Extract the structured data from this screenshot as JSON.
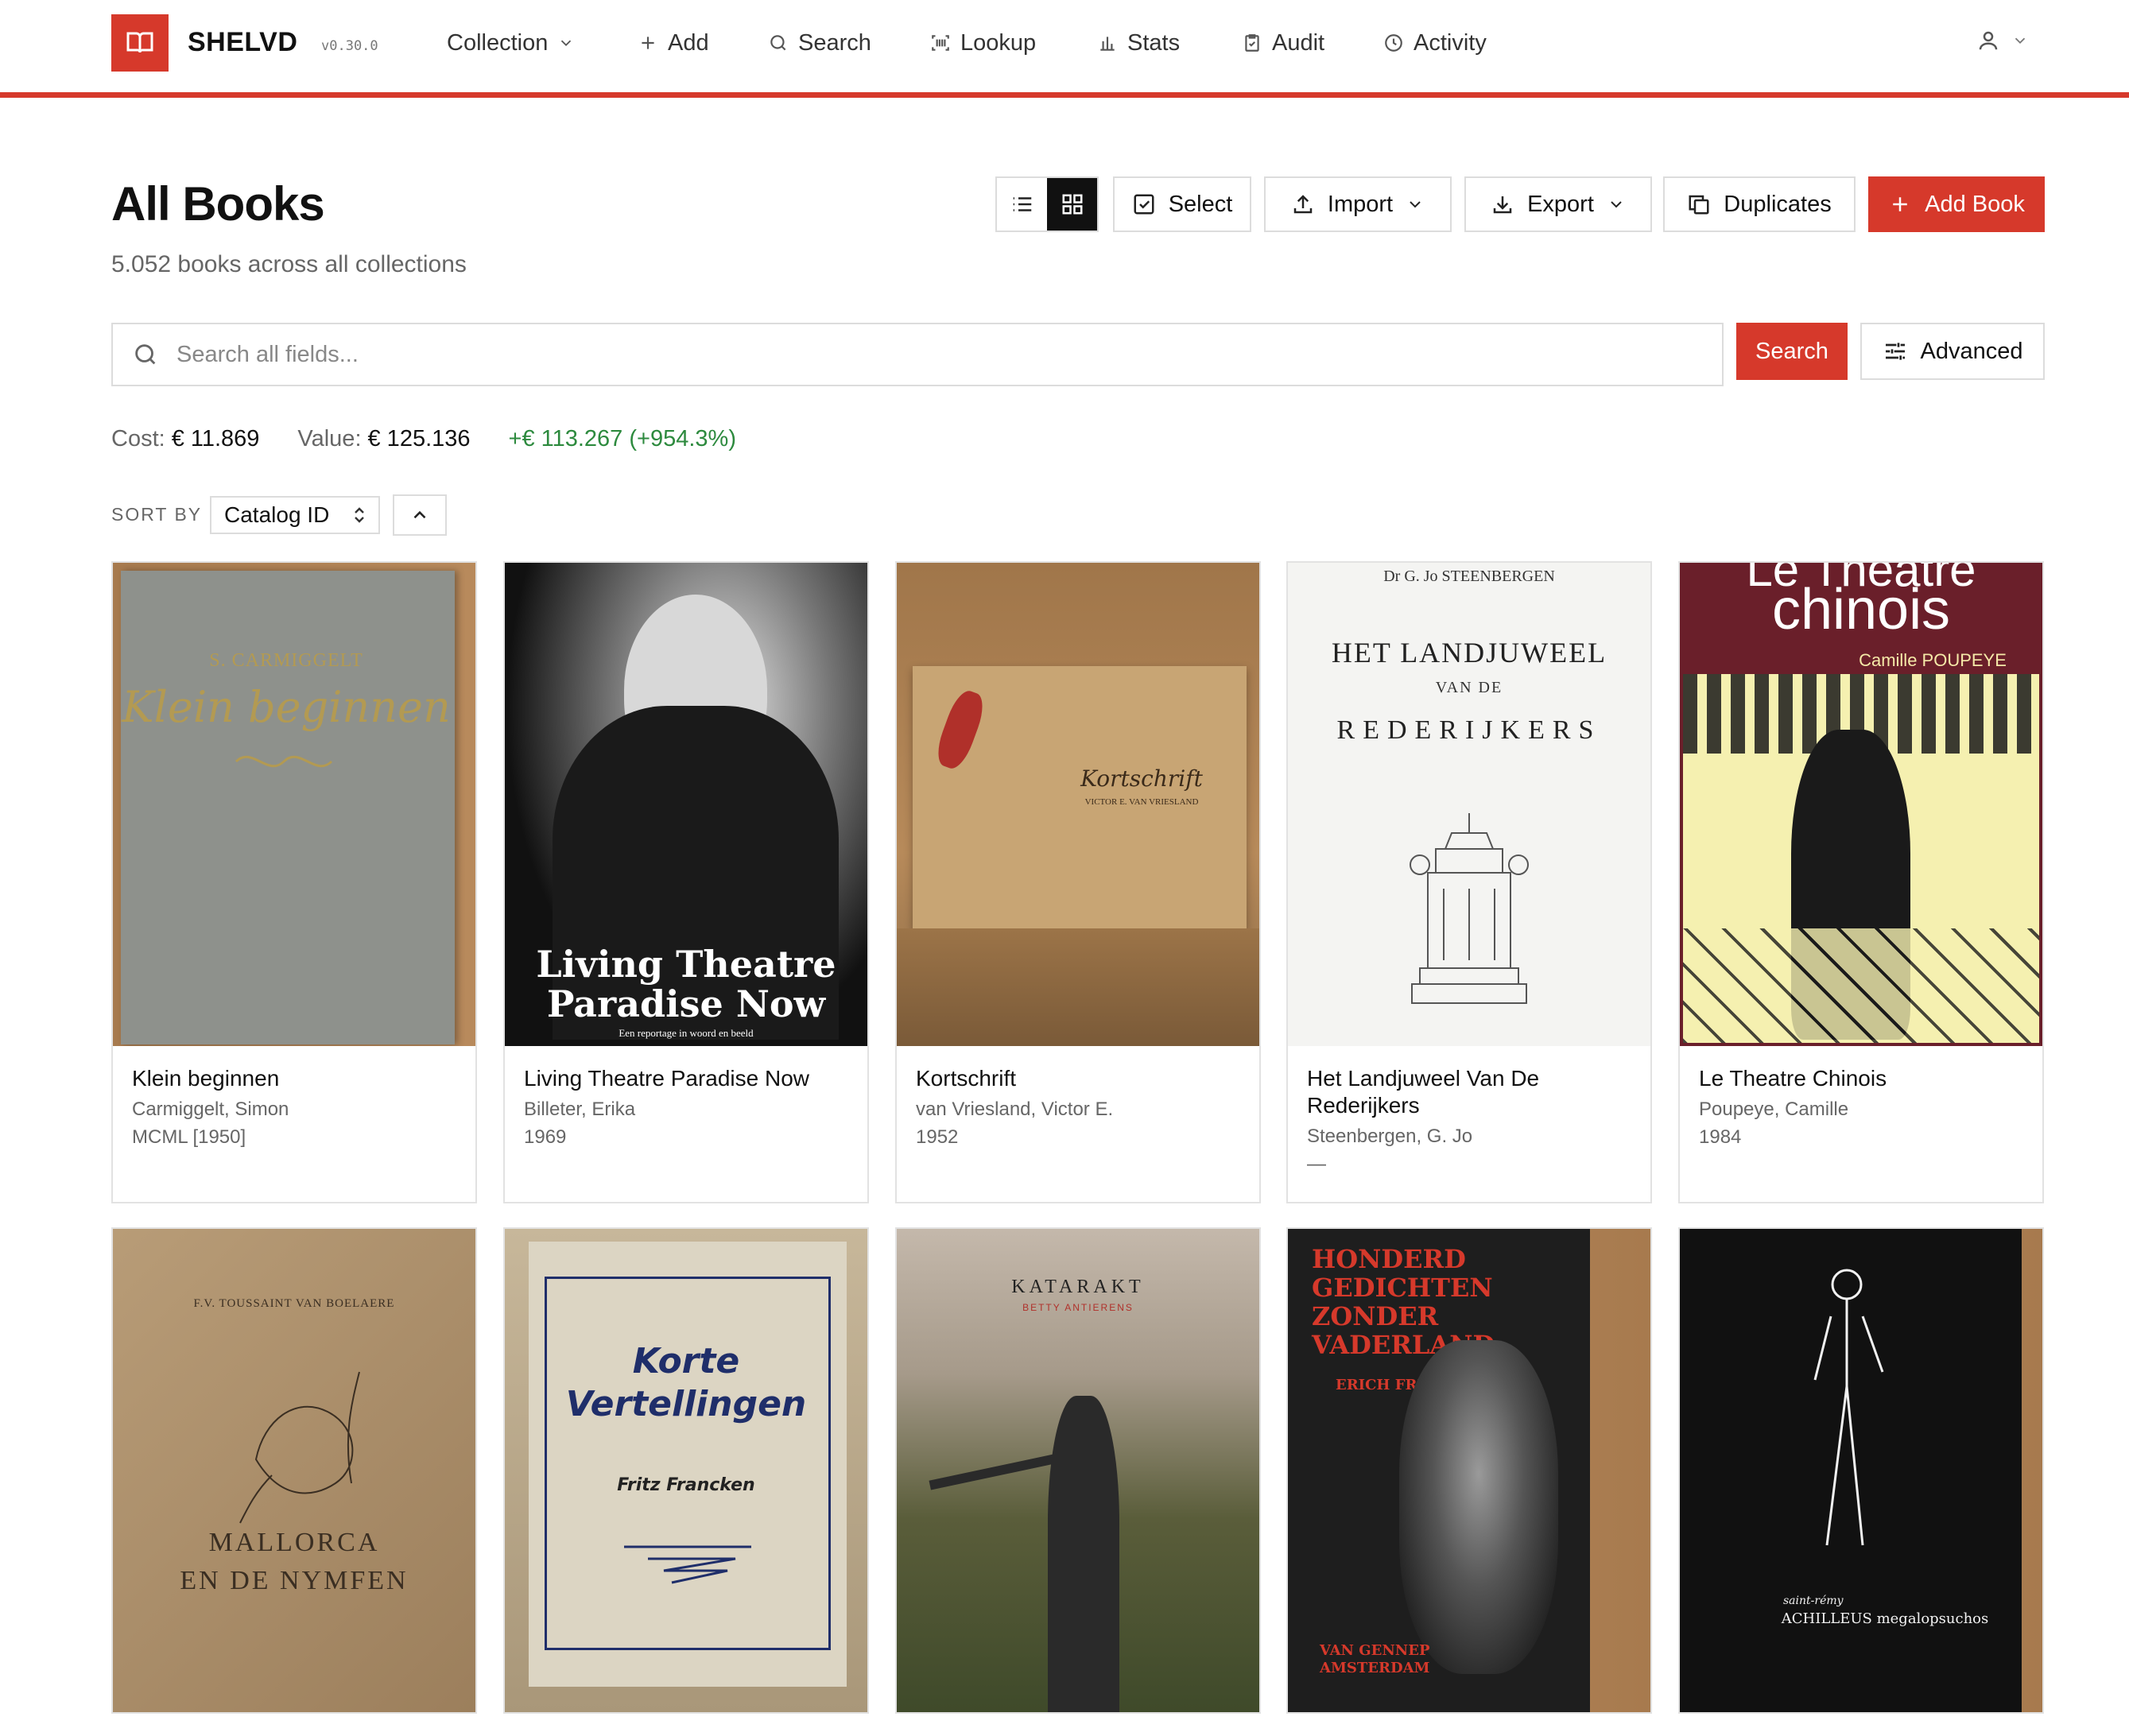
{
  "app": {
    "brand": "SHELVD",
    "version": "v0.30.0"
  },
  "nav": {
    "collection": "Collection",
    "add": "Add",
    "search": "Search",
    "lookup": "Lookup",
    "stats": "Stats",
    "audit": "Audit",
    "activity": "Activity"
  },
  "header": {
    "title": "All Books",
    "subtitle": "5.052 books across all collections"
  },
  "toolbar": {
    "select": "Select",
    "import": "Import",
    "export": "Export",
    "duplicates": "Duplicates",
    "add_book": "Add Book"
  },
  "search": {
    "placeholder": "Search all fields...",
    "value": "",
    "button": "Search",
    "advanced": "Advanced"
  },
  "stats": {
    "cost_label": "Cost:",
    "cost_value": "€ 11.869",
    "value_label": "Value:",
    "value_value": "€ 125.136",
    "gain": "+€ 113.267 (+954.3%)"
  },
  "sort": {
    "label": "SORT BY",
    "selected": "Catalog ID",
    "direction": "ascending"
  },
  "books": [
    {
      "title": "Klein beginnen",
      "author": "Carmiggelt, Simon",
      "year": "MCML [1950]",
      "cover_color": "#8e918c",
      "cover_text_top": "S. CARMIGGELT",
      "cover_text_main": "Klein beginnen"
    },
    {
      "title": "Living Theatre Paradise Now",
      "author": "Billeter, Erika",
      "year": "1969",
      "cover_color": "#151515",
      "cover_text_top": "",
      "cover_text_main": "Living Theatre Paradise Now",
      "cover_text_small": "Een reportage in woord en beeld"
    },
    {
      "title": "Kortschrift",
      "author": "van Vriesland, Victor E.",
      "year": "1952",
      "cover_color": "#c8a574",
      "cover_text_top": "",
      "cover_text_main": "Kortschrift",
      "cover_text_small": "VICTOR E. VAN VRIESLAND"
    },
    {
      "title": "Het Landjuweel Van De Rederijkers",
      "author": "Steenbergen, G. Jo",
      "year": "—",
      "cover_color": "#f4f4f2",
      "cover_text_top": "Dr G. Jo STEENBERGEN",
      "cover_text_main": "HET LANDJUWEEL",
      "cover_text_mid": "VAN DE",
      "cover_text_bottom": "REDERIJKERS"
    },
    {
      "title": "Le Theatre Chinois",
      "author": "Poupeye, Camille",
      "year": "1984",
      "cover_color": "#6a1f2a",
      "cover_text_top": "Le Théâtre",
      "cover_text_main": "chinois",
      "cover_text_small": "Camille POUPEYE"
    },
    {
      "title": "",
      "author": "",
      "year": "",
      "cover_color": "#b59a75",
      "cover_text_top": "F.V. TOUSSAINT VAN BOELAERE",
      "cover_text_main": "MALLORCA",
      "cover_text_bottom": "EN DE NYMFEN"
    },
    {
      "title": "",
      "author": "",
      "year": "",
      "cover_color": "#d9d2c0",
      "cover_text_top": "",
      "cover_text_main": "Korte Vertellingen",
      "cover_text_small": "Fritz Francken"
    },
    {
      "title": "",
      "author": "",
      "year": "",
      "cover_color": "#8a8a70",
      "cover_text_top": "KATARAKT",
      "cover_text_main": "",
      "cover_text_small": "BETTY ANTIERENS"
    },
    {
      "title": "",
      "author": "",
      "year": "",
      "cover_color": "#2b2b2b",
      "cover_text_top": "HONDERD GEDICHTEN ZONDER VADERLAND",
      "cover_text_main": "",
      "cover_text_small": "ERICH FRIED",
      "cover_text_bottom": "VAN GENNEP AMSTERDAM"
    },
    {
      "title": "",
      "author": "",
      "year": "",
      "cover_color": "#111111",
      "cover_text_top": "",
      "cover_text_main": "ACHILLEUS megalopsuchos",
      "cover_text_small": "saint-rémy"
    }
  ],
  "colors": {
    "accent": "#d6392b",
    "gain": "#2d8a3e",
    "border": "#dcdcdc"
  }
}
